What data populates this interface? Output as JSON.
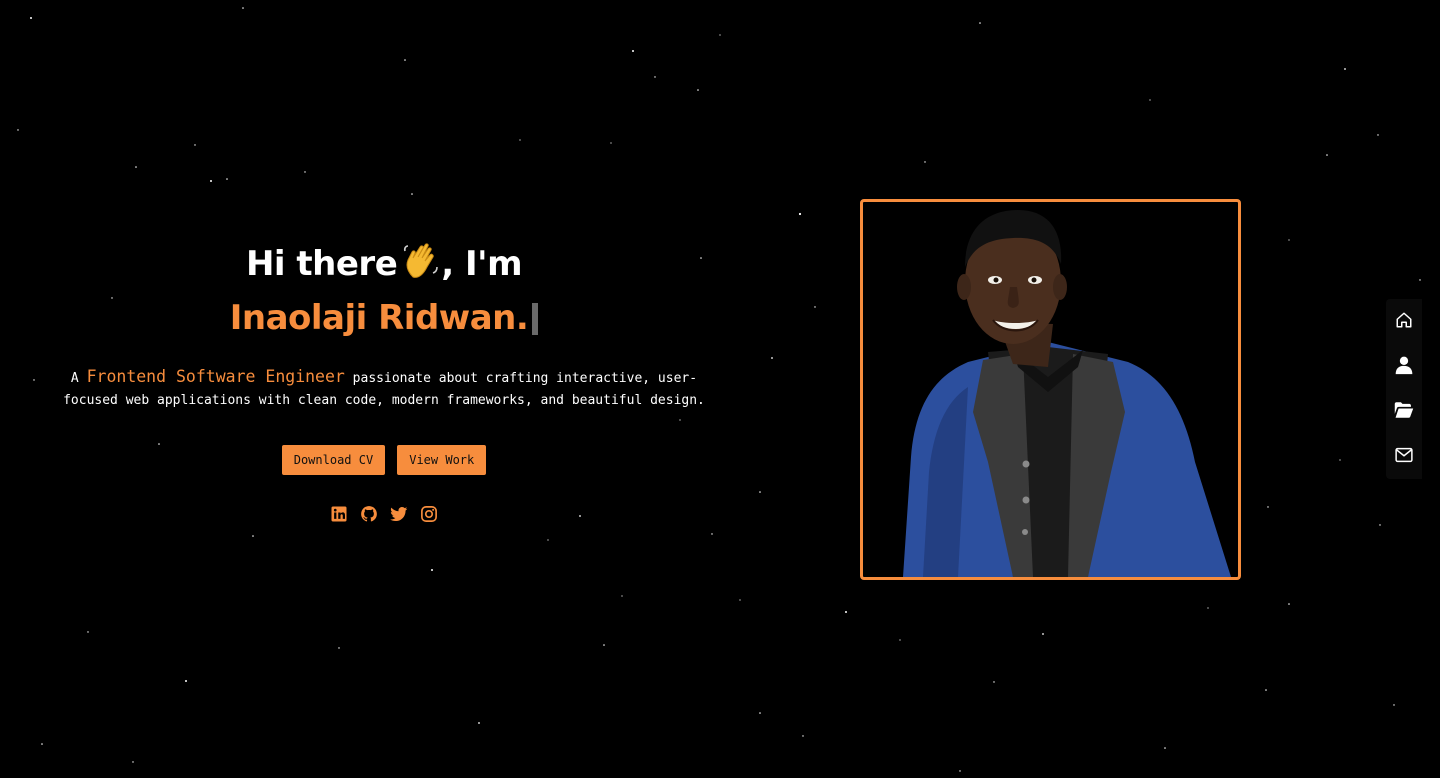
{
  "hero": {
    "greeting_prefix": "Hi there",
    "greeting_suffix": ", I'm",
    "name": "Inaolaji Ridwan.",
    "intro_prefix": "A ",
    "role": "Frontend Software Engineer",
    "intro_suffix": " passionate about crafting interactive, user-focused web applications with clean code, modern frameworks, and beautiful design.",
    "buttons": {
      "download_cv": "Download CV",
      "view_work": "View Work"
    },
    "socials": [
      "linkedin-icon",
      "github-icon",
      "twitter-icon",
      "instagram-icon"
    ]
  },
  "side_nav": {
    "items": [
      "home-icon",
      "user-icon",
      "folder-open-icon",
      "mail-icon"
    ]
  },
  "colors": {
    "accent": "#f78d3d",
    "background": "#000000",
    "text": "#ffffff"
  }
}
